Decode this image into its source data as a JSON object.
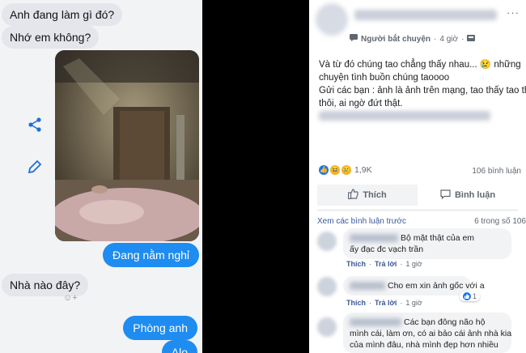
{
  "chat": {
    "incoming": [
      "Anh đang làm gì đó?",
      "Nhớ em không?",
      "Nhà nào đây?"
    ],
    "outgoing": [
      "Đang nằm nghỉ",
      "Phòng anh",
      "Alo"
    ],
    "icons": [
      "share-icon",
      "edit-pencil-icon",
      "add-reaction-icon"
    ],
    "accent": "#1e8cf0"
  },
  "post": {
    "meta_user": "Người bắt chuyện",
    "meta_time": "4 giờ",
    "text_lines": [
      "Và từ đó chúng tao chẳng thấy nhau... 😢 những",
      "chuyện tình buồn chúng taoooo",
      "Gửi các bạn : ảnh là ảnh trên mạng, tao thấy tao thử",
      "thôi, ai ngờ đứt thật."
    ],
    "reaction_count": "1,9K",
    "comment_count": "106 bình luận",
    "like_label": "Thích",
    "comment_label": "Bình luận",
    "view_previous": "Xem các bình luận trước",
    "page_count": "6 trong số 106",
    "comments": [
      {
        "text_lines": [
          "Bộ mặt thật của em",
          "ấy đạc đc vạch trần"
        ],
        "like": "Thích",
        "reply": "Trả lời",
        "time": "1 giờ"
      },
      {
        "text_lines": [
          "Cho em xin ảnh gốc với a"
        ],
        "like": "Thích",
        "reply": "Trả lời",
        "time": "1 giờ",
        "likes": "1"
      },
      {
        "text_lines": [
          "Các bạn đông não hộ",
          "mình cái, làm ơn, có ai bảo cái ảnh nhà kia",
          "của mình đâu, nhà mình đẹp hơn nhiều"
        ]
      }
    ],
    "brand": "#1877f2"
  }
}
